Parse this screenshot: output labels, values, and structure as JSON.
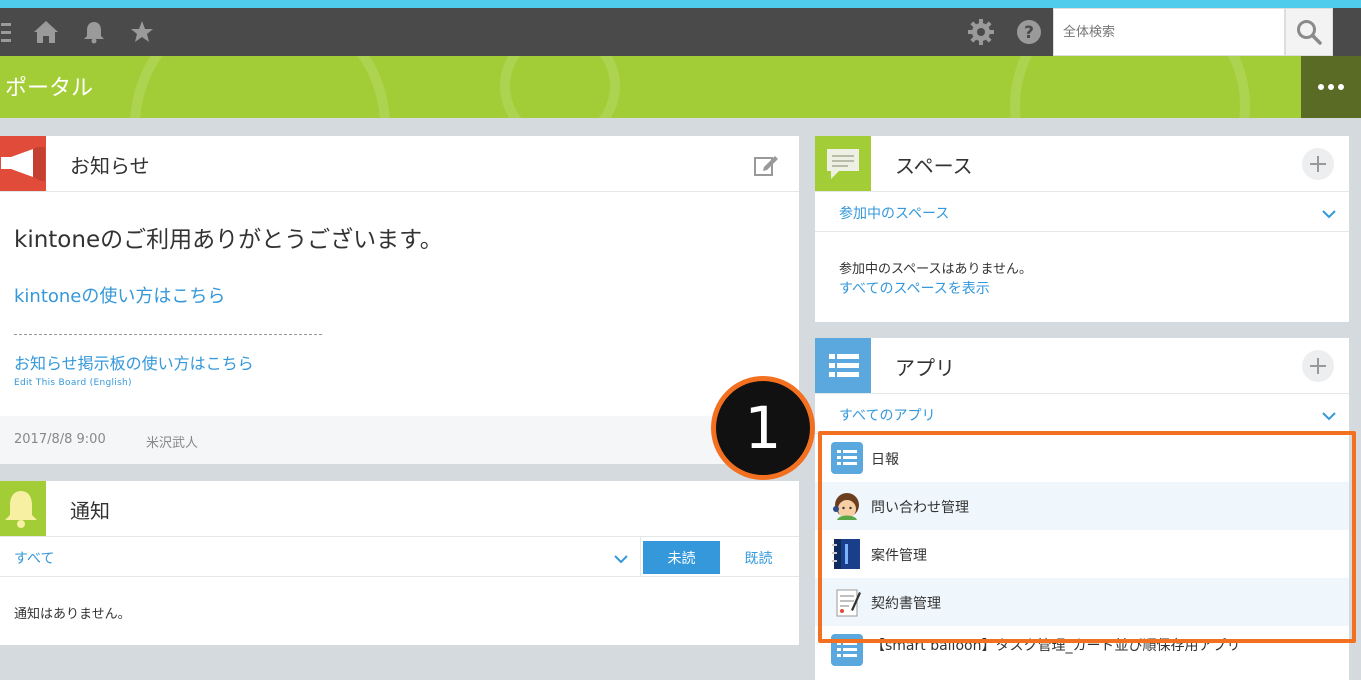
{
  "search": {
    "placeholder": "全体検索"
  },
  "portal": {
    "title": "ポータル"
  },
  "notice": {
    "title": "お知らせ",
    "body_title": "kintoneのご利用ありがとうございます。",
    "link_howto": "kintoneの使い方はこちら",
    "divider": "--------------------------------------------------------",
    "link_board": "お知らせ掲示板の使い方はこちら",
    "link_edit": "Edit This Board (English)",
    "date": "2017/8/8 9:00",
    "author": "米沢武人"
  },
  "notifications": {
    "title": "通知",
    "filter": "すべて",
    "unread": "未読",
    "read": "既読",
    "empty": "通知はありません。"
  },
  "space": {
    "title": "スペース",
    "filter": "参加中のスペース",
    "empty": "参加中のスペースはありません。",
    "link_all": "すべてのスペースを表示"
  },
  "apps": {
    "title": "アプリ",
    "filter": "すべてのアプリ",
    "items": [
      {
        "name": "日報",
        "icon": "list-app-icon"
      },
      {
        "name": "問い合わせ管理",
        "icon": "support-person-icon"
      },
      {
        "name": "案件管理",
        "icon": "binder-icon"
      },
      {
        "name": "契約書管理",
        "icon": "document-pen-icon"
      },
      {
        "name": "【smart balloon】タスク管理_カード並び順保存用アプリ",
        "icon": "list-app-icon"
      }
    ]
  },
  "annotation": {
    "step": "1"
  },
  "colors": {
    "accent_bar": "#4fcbeb",
    "portal_green": "#a3cd36",
    "link_blue": "#3498db",
    "highlight_orange": "#f37021"
  }
}
